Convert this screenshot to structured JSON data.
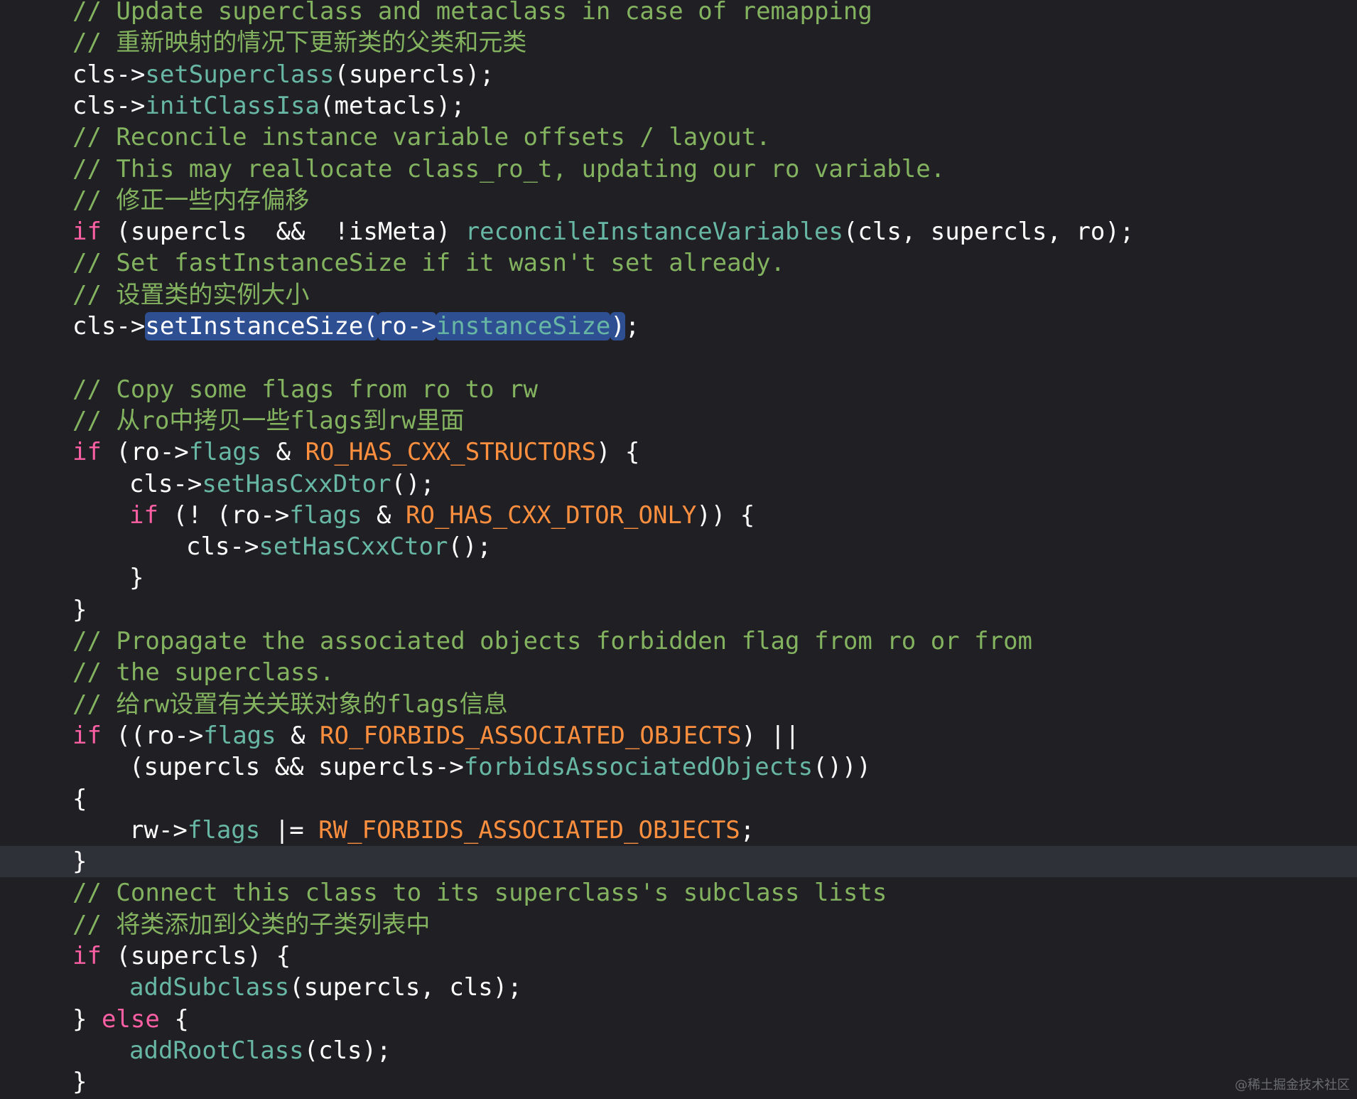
{
  "editor": {
    "theme": {
      "background": "#1f1f24",
      "current_line": "#2f3139",
      "plain": "#ffffff",
      "comment": "#84b360",
      "keyword": "#fc5fa3",
      "function": "#67b7a4",
      "macro": "#fd8f3f",
      "selection": "#2f4f93"
    },
    "lines": [
      {
        "indent": 1,
        "tokens": [
          {
            "t": "// Update superclass and metaclass in case of remapping",
            "c": "comment"
          }
        ]
      },
      {
        "indent": 1,
        "tokens": [
          {
            "t": "// 重新映射的情况下更新类的父类和元类",
            "c": "comment"
          }
        ]
      },
      {
        "indent": 1,
        "tokens": [
          {
            "t": "cls->",
            "c": "plain"
          },
          {
            "t": "setSuperclass",
            "c": "func"
          },
          {
            "t": "(supercls);",
            "c": "plain"
          }
        ]
      },
      {
        "indent": 1,
        "tokens": [
          {
            "t": "cls->",
            "c": "plain"
          },
          {
            "t": "initClassIsa",
            "c": "func"
          },
          {
            "t": "(metacls);",
            "c": "plain"
          }
        ]
      },
      {
        "indent": 1,
        "tokens": [
          {
            "t": "// Reconcile instance variable offsets / layout.",
            "c": "comment"
          }
        ]
      },
      {
        "indent": 1,
        "tokens": [
          {
            "t": "// This may reallocate class_ro_t, updating our ro variable.",
            "c": "comment"
          }
        ]
      },
      {
        "indent": 1,
        "tokens": [
          {
            "t": "// 修正一些内存偏移",
            "c": "comment"
          }
        ]
      },
      {
        "indent": 1,
        "tokens": [
          {
            "t": "if",
            "c": "keyword"
          },
          {
            "t": " (supercls  &&  !isMeta) ",
            "c": "plain"
          },
          {
            "t": "reconcileInstanceVariables",
            "c": "func"
          },
          {
            "t": "(cls, supercls, ro);",
            "c": "plain"
          }
        ]
      },
      {
        "indent": 1,
        "tokens": [
          {
            "t": "// Set fastInstanceSize if it wasn't set already.",
            "c": "comment"
          }
        ]
      },
      {
        "indent": 1,
        "tokens": [
          {
            "t": "// 设置类的实例大小",
            "c": "comment"
          }
        ]
      },
      {
        "indent": 1,
        "tokens": [
          {
            "t": "cls->",
            "c": "plain"
          },
          {
            "t": "setInstanceSize(",
            "c": "plain",
            "sel": true
          },
          {
            "t": "ro->",
            "c": "plain",
            "sel": true
          },
          {
            "t": "instanceSize",
            "c": "func",
            "sel": true
          },
          {
            "t": ")",
            "c": "plain",
            "sel": true
          },
          {
            "t": ";",
            "c": "plain"
          }
        ]
      },
      {
        "indent": 0,
        "tokens": []
      },
      {
        "indent": 1,
        "tokens": [
          {
            "t": "// Copy some flags from ro to rw",
            "c": "comment"
          }
        ]
      },
      {
        "indent": 1,
        "tokens": [
          {
            "t": "// 从ro中拷贝一些flags到rw里面",
            "c": "comment"
          }
        ]
      },
      {
        "indent": 1,
        "tokens": [
          {
            "t": "if",
            "c": "keyword"
          },
          {
            "t": " (ro->",
            "c": "plain"
          },
          {
            "t": "flags",
            "c": "func"
          },
          {
            "t": " & ",
            "c": "plain"
          },
          {
            "t": "RO_HAS_CXX_STRUCTORS",
            "c": "macro"
          },
          {
            "t": ") {",
            "c": "plain"
          }
        ]
      },
      {
        "indent": 2,
        "tokens": [
          {
            "t": "cls->",
            "c": "plain"
          },
          {
            "t": "setHasCxxDtor",
            "c": "func"
          },
          {
            "t": "();",
            "c": "plain"
          }
        ]
      },
      {
        "indent": 2,
        "tokens": [
          {
            "t": "if",
            "c": "keyword"
          },
          {
            "t": " (! (ro->",
            "c": "plain"
          },
          {
            "t": "flags",
            "c": "func"
          },
          {
            "t": " & ",
            "c": "plain"
          },
          {
            "t": "RO_HAS_CXX_DTOR_ONLY",
            "c": "macro"
          },
          {
            "t": ")) {",
            "c": "plain"
          }
        ]
      },
      {
        "indent": 3,
        "tokens": [
          {
            "t": "cls->",
            "c": "plain"
          },
          {
            "t": "setHasCxxCtor",
            "c": "func"
          },
          {
            "t": "();",
            "c": "plain"
          }
        ]
      },
      {
        "indent": 2,
        "tokens": [
          {
            "t": "}",
            "c": "plain"
          }
        ]
      },
      {
        "indent": 1,
        "tokens": [
          {
            "t": "}",
            "c": "plain"
          }
        ]
      },
      {
        "indent": 1,
        "tokens": [
          {
            "t": "// Propagate the associated objects forbidden flag from ro or from",
            "c": "comment"
          }
        ]
      },
      {
        "indent": 1,
        "tokens": [
          {
            "t": "// the superclass.",
            "c": "comment"
          }
        ]
      },
      {
        "indent": 1,
        "tokens": [
          {
            "t": "// 给rw设置有关关联对象的flags信息",
            "c": "comment"
          }
        ]
      },
      {
        "indent": 1,
        "tokens": [
          {
            "t": "if",
            "c": "keyword"
          },
          {
            "t": " ((ro->",
            "c": "plain"
          },
          {
            "t": "flags",
            "c": "func"
          },
          {
            "t": " & ",
            "c": "plain"
          },
          {
            "t": "RO_FORBIDS_ASSOCIATED_OBJECTS",
            "c": "macro"
          },
          {
            "t": ") ||",
            "c": "plain"
          }
        ]
      },
      {
        "indent": 2,
        "tokens": [
          {
            "t": "(supercls && supercls->",
            "c": "plain"
          },
          {
            "t": "forbidsAssociatedObjects",
            "c": "func"
          },
          {
            "t": "()))",
            "c": "plain"
          }
        ]
      },
      {
        "indent": 1,
        "tokens": [
          {
            "t": "{",
            "c": "plain"
          }
        ]
      },
      {
        "indent": 2,
        "tokens": [
          {
            "t": "rw->",
            "c": "plain"
          },
          {
            "t": "flags",
            "c": "func"
          },
          {
            "t": " |= ",
            "c": "plain"
          },
          {
            "t": "RW_FORBIDS_ASSOCIATED_OBJECTS",
            "c": "macro"
          },
          {
            "t": ";",
            "c": "plain"
          }
        ]
      },
      {
        "indent": 1,
        "current": true,
        "tokens": [
          {
            "t": "}",
            "c": "plain"
          }
        ]
      },
      {
        "indent": 1,
        "tokens": [
          {
            "t": "// Connect this class to its superclass's subclass lists",
            "c": "comment"
          }
        ]
      },
      {
        "indent": 1,
        "tokens": [
          {
            "t": "// 将类添加到父类的子类列表中",
            "c": "comment"
          }
        ]
      },
      {
        "indent": 1,
        "tokens": [
          {
            "t": "if",
            "c": "keyword"
          },
          {
            "t": " (supercls) {",
            "c": "plain"
          }
        ]
      },
      {
        "indent": 2,
        "tokens": [
          {
            "t": "addSubclass",
            "c": "func"
          },
          {
            "t": "(supercls, cls);",
            "c": "plain"
          }
        ]
      },
      {
        "indent": 1,
        "tokens": [
          {
            "t": "} ",
            "c": "plain"
          },
          {
            "t": "else",
            "c": "keyword"
          },
          {
            "t": " {",
            "c": "plain"
          }
        ]
      },
      {
        "indent": 2,
        "tokens": [
          {
            "t": "addRootClass",
            "c": "func"
          },
          {
            "t": "(cls);",
            "c": "plain"
          }
        ]
      },
      {
        "indent": 1,
        "tokens": [
          {
            "t": "}",
            "c": "plain"
          }
        ]
      }
    ]
  },
  "watermark": "@稀土掘金技术社区"
}
